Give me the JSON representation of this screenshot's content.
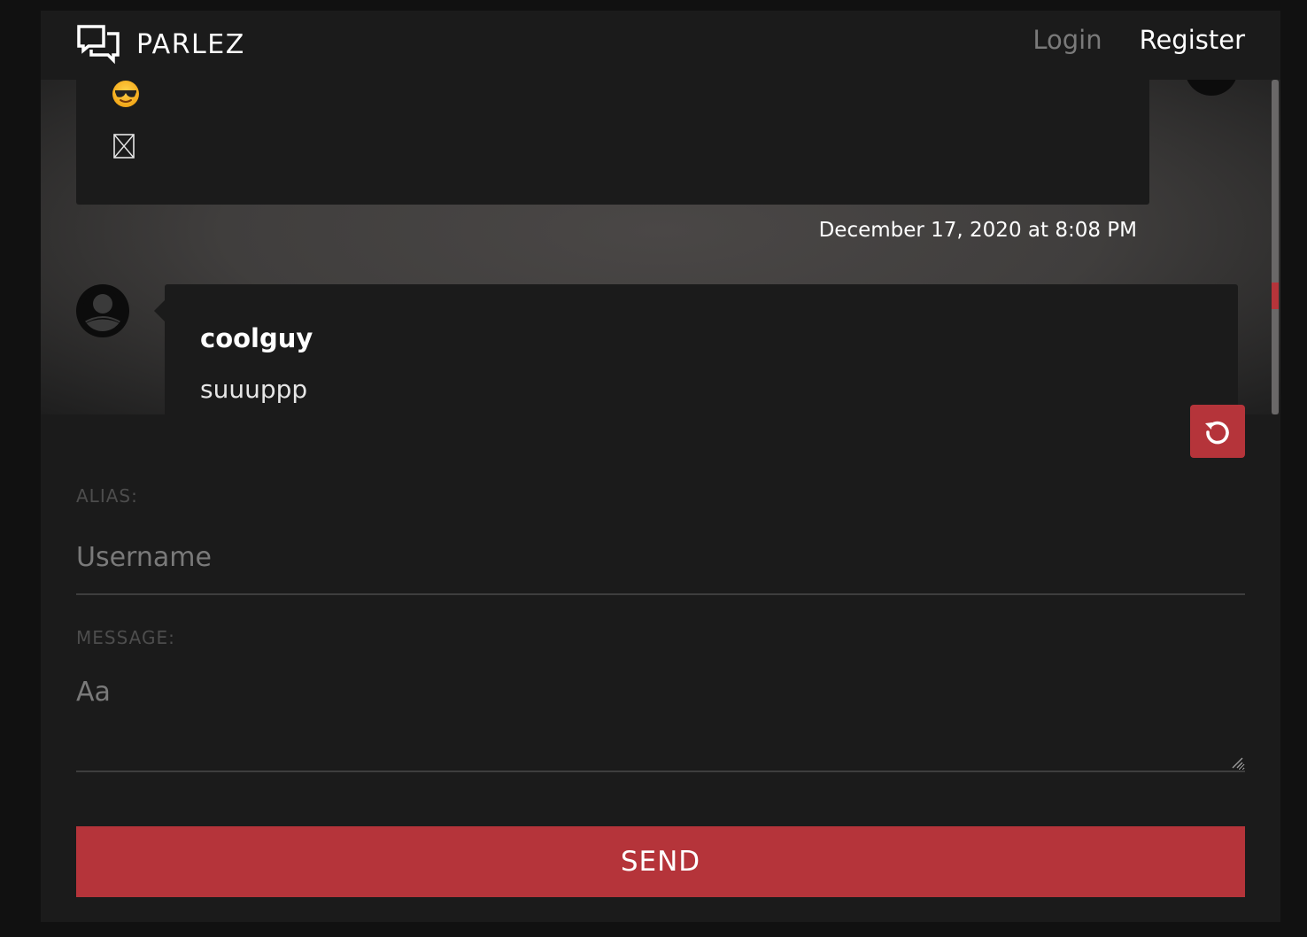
{
  "header": {
    "brand": "PARLEZ",
    "nav": {
      "login": "Login",
      "register": "Register"
    }
  },
  "messages": [
    {
      "emoji": "😎",
      "timestamp": "December 17, 2020 at 8:08 PM"
    },
    {
      "username": "coolguy",
      "text": "suuuppp"
    }
  ],
  "form": {
    "alias_label": "ALIAS:",
    "alias_placeholder": "Username",
    "message_label": "MESSAGE:",
    "message_placeholder": "Aa",
    "send_label": "SEND"
  },
  "icons": {
    "brand": "chat-bubbles-icon",
    "refresh": "refresh-icon",
    "avatar": "user-avatar-icon",
    "broken_image": "broken-image-icon"
  },
  "colors": {
    "accent": "#b5343a",
    "background": "#1b1b1b",
    "chat_background": "#403e3d"
  }
}
